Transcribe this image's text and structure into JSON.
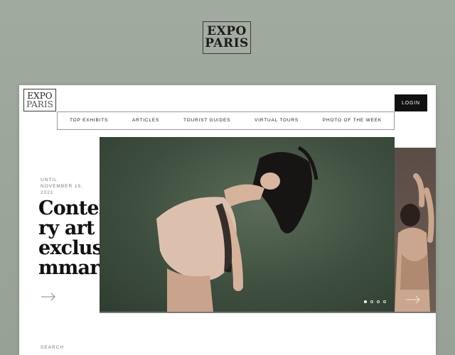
{
  "brand": {
    "line1": "EXPO",
    "line2": "PARIS"
  },
  "nav": {
    "items": [
      "TOP EXHIBITS",
      "ARTICLES",
      "TOURIST GUIDES",
      "VIRTUAL TOURS",
      "PHOTO OF THE WEEK"
    ]
  },
  "login_label": "LOGIN",
  "hero": {
    "date_line1": "UNTIL",
    "date_line2": "NOVEMBER 15,",
    "date_line3": "2021",
    "headline": "Contemporary art in an exclusive summary"
  },
  "slider": {
    "slide_count": 4,
    "active_slide": 1
  },
  "search_label": "SEARCH",
  "colors": {
    "background": "#9ea79c",
    "accent": "#111111",
    "hero_bg": "#3e4f3f"
  }
}
